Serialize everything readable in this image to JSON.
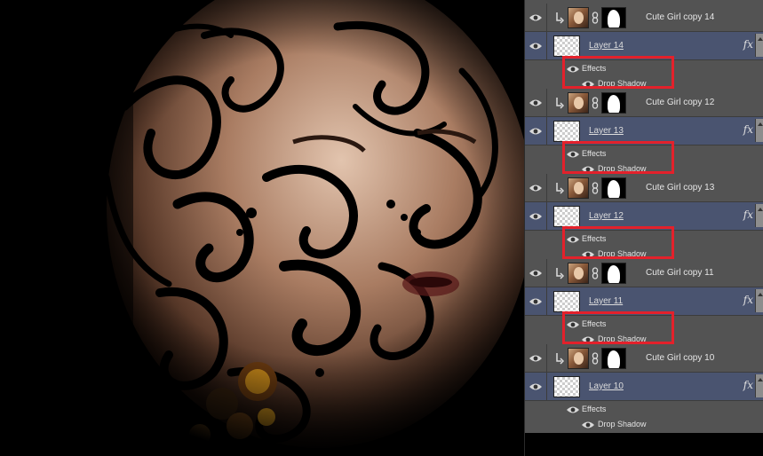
{
  "panel": {
    "rows": [
      {
        "kind": "clipped",
        "name": "Cute Girl copy 14"
      },
      {
        "kind": "fx-layer",
        "name": "Layer 14",
        "fx": "fx",
        "effects": "Effects",
        "effect": "Drop Shadow",
        "highlighted": true
      },
      {
        "kind": "clipped",
        "name": "Cute Girl copy 12"
      },
      {
        "kind": "fx-layer",
        "name": "Layer 13",
        "fx": "fx",
        "effects": "Effects",
        "effect": "Drop Shadow",
        "highlighted": true
      },
      {
        "kind": "clipped",
        "name": "Cute Girl copy 13"
      },
      {
        "kind": "fx-layer",
        "name": "Layer 12",
        "fx": "fx",
        "effects": "Effects",
        "effect": "Drop Shadow",
        "highlighted": true
      },
      {
        "kind": "clipped",
        "name": "Cute Girl copy 11"
      },
      {
        "kind": "fx-layer",
        "name": "Layer 11",
        "fx": "fx",
        "effects": "Effects",
        "effect": "Drop Shadow",
        "highlighted": true
      },
      {
        "kind": "clipped",
        "name": "Cute Girl copy 10"
      },
      {
        "kind": "fx-layer",
        "name": "Layer 10",
        "fx": "fx",
        "effects": "Effects",
        "effect": "Drop Shadow",
        "highlighted": false
      }
    ]
  },
  "colors": {
    "panel_bg": "#535353",
    "selected_row": "#4a5470",
    "highlight_box": "#e3212b"
  }
}
